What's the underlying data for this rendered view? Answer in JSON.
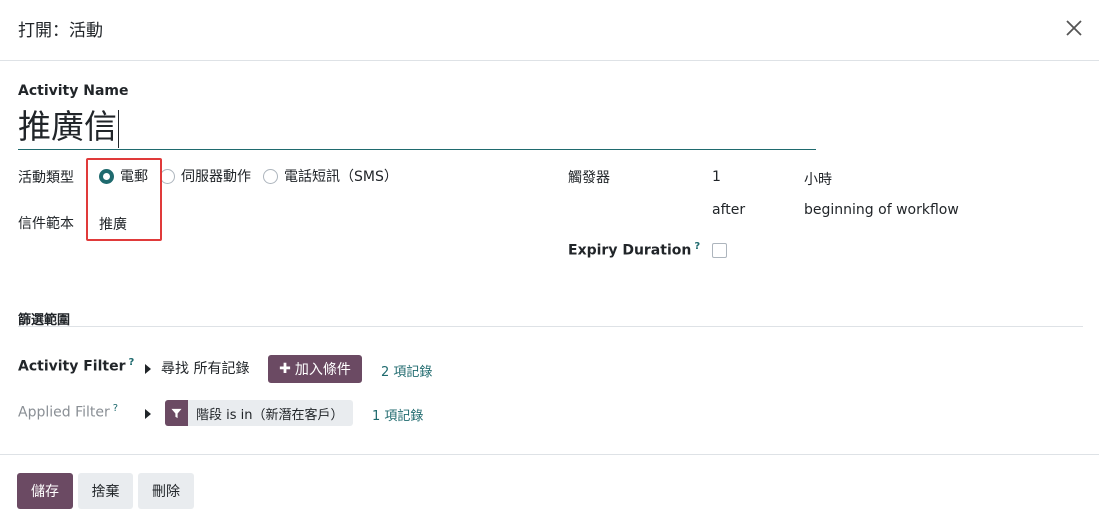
{
  "dialog": {
    "title": "打開：活動"
  },
  "activity": {
    "name_label": "Activity Name",
    "name_value": "推廣信"
  },
  "activity_type": {
    "label": "活動類型",
    "options": [
      {
        "label": "電郵",
        "checked": true
      },
      {
        "label": "伺服器動作",
        "checked": false
      },
      {
        "label": "電話短訊（SMS）",
        "checked": false
      }
    ]
  },
  "mail_template": {
    "label": "信件範本",
    "value": "推廣"
  },
  "trigger": {
    "label": "觸發器",
    "interval": "1",
    "unit": "小時",
    "when": "after",
    "reference": "beginning of workflow"
  },
  "expiry": {
    "label": "Expiry Duration",
    "help": "?",
    "checked": false
  },
  "filter_section": {
    "title": "篩選範圍"
  },
  "activity_filter": {
    "label": "Activity Filter",
    "help": "?",
    "find_text": "尋找 所有記錄",
    "add_button": "加入條件",
    "records_link": "2 項記錄"
  },
  "applied_filter": {
    "label": "Applied Filter",
    "help": "?",
    "tag_text": "階段 is in（新潛在客戶）",
    "records_link": "1 項記錄"
  },
  "footer": {
    "save": "儲存",
    "discard": "捨棄",
    "delete": "刪除"
  },
  "colors": {
    "primary": "#6b4a63",
    "accent": "#1f6a6e",
    "highlight": "#e03a3a"
  }
}
